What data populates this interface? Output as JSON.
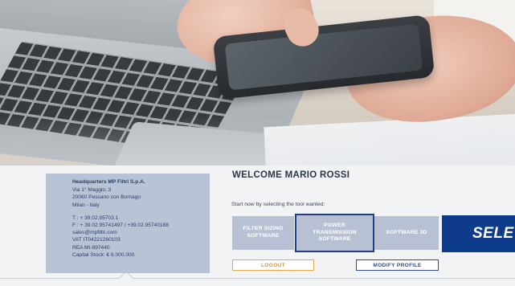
{
  "company": {
    "headquarters": "Headquarters MP Filtri S.p.A.",
    "address_line1": "Via 1° Maggio, 3",
    "address_line2": "20060 Pessano con Bornago",
    "address_line3": "Milan - Italy",
    "phone": "T : + 39.02.95703.1",
    "fax": "F : + 39.02.95741497 / +39.02.95740188",
    "email": "sales@mpfiltri.com",
    "vat": "VAT IT04221260103",
    "rea": "REA MI-997440",
    "capital": "Capital Stock: € 6.000.000"
  },
  "welcome": {
    "title": "WELCOME MARIO ROSSI",
    "subtitle": "Start now by selecting the tool wanted:"
  },
  "tools": [
    {
      "line1": "FILTER SIZING",
      "line2": "SOFTWARE",
      "line3": ""
    },
    {
      "line1": "POWER",
      "line2": "TRANSMISSION",
      "line3": "SOFTWARE"
    },
    {
      "line1": "SOFTWARE 3D",
      "line2": "",
      "line3": ""
    },
    {
      "line1": "SELE",
      "line2": "",
      "line3": ""
    }
  ],
  "actions": {
    "logout": "LOGOUT",
    "modify_profile": "MODIFY PROFILE"
  },
  "colors": {
    "card_bg": "#b9c3d6",
    "tile_bg": "#b7c1d3",
    "selected_border": "#1f3f82",
    "dark_tile": "#0f3c8a",
    "logout_accent": "#e5a84b",
    "profile_accent": "#2e4e8f"
  }
}
